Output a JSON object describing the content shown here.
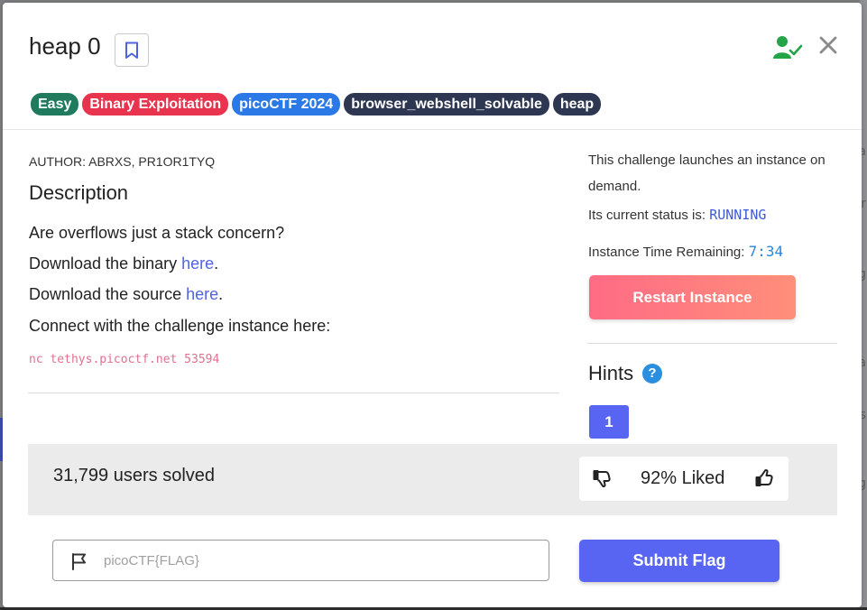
{
  "challenge": {
    "title": "heap 0",
    "tags": [
      {
        "label": "Easy",
        "color": "#1f7a5e"
      },
      {
        "label": "Binary Exploitation",
        "color": "#e8344e"
      },
      {
        "label": "picoCTF 2024",
        "color": "#2a79e6"
      },
      {
        "label": "browser_webshell_solvable",
        "color": "#2d3752"
      },
      {
        "label": "heap",
        "color": "#2d3752"
      }
    ],
    "author": "AUTHOR: ABRXS, PR1OR1TYQ",
    "description_heading": "Description",
    "description": {
      "line1": "Are overflows just a stack concern?",
      "line2_prefix": "Download the binary ",
      "line2_link": "here",
      "line2_suffix": ".",
      "line3_prefix": "Download the source ",
      "line3_link": "here",
      "line3_suffix": ".",
      "line4": "Connect with the challenge instance here:",
      "command": "nc tethys.picoctf.net 53594"
    }
  },
  "instance": {
    "launch_text_1": "This challenge launches an instance on",
    "launch_text_2": "demand.",
    "status_label": "Its current status is: ",
    "status_value": "RUNNING",
    "time_label": "Instance Time Remaining: ",
    "time_value": "7:34",
    "restart_label": "Restart Instance"
  },
  "hints": {
    "heading": "Hints",
    "help_glyph": "?",
    "items": [
      "1"
    ]
  },
  "stats": {
    "solved_text": "31,799 users solved",
    "liked_text": "92% Liked"
  },
  "flag": {
    "placeholder": "picoCTF{FLAG}",
    "submit_label": "Submit Flag"
  },
  "background": {
    "letters": [
      "a",
      "r",
      "g",
      "a",
      "s",
      "g"
    ]
  },
  "colors": {
    "accent": "#5865f2",
    "restart_gradient_start": "#ff6b85",
    "restart_gradient_end": "#ff8f7a",
    "status": "#3d5bd9",
    "user_check": "#22a447"
  },
  "icons": {
    "bookmark": "bookmark-icon",
    "user_check": "user-check-icon",
    "close": "close-icon",
    "help": "help-circle-icon",
    "thumb_down": "thumbs-down-icon",
    "thumb_up": "thumbs-up-icon",
    "flag": "flag-icon"
  }
}
